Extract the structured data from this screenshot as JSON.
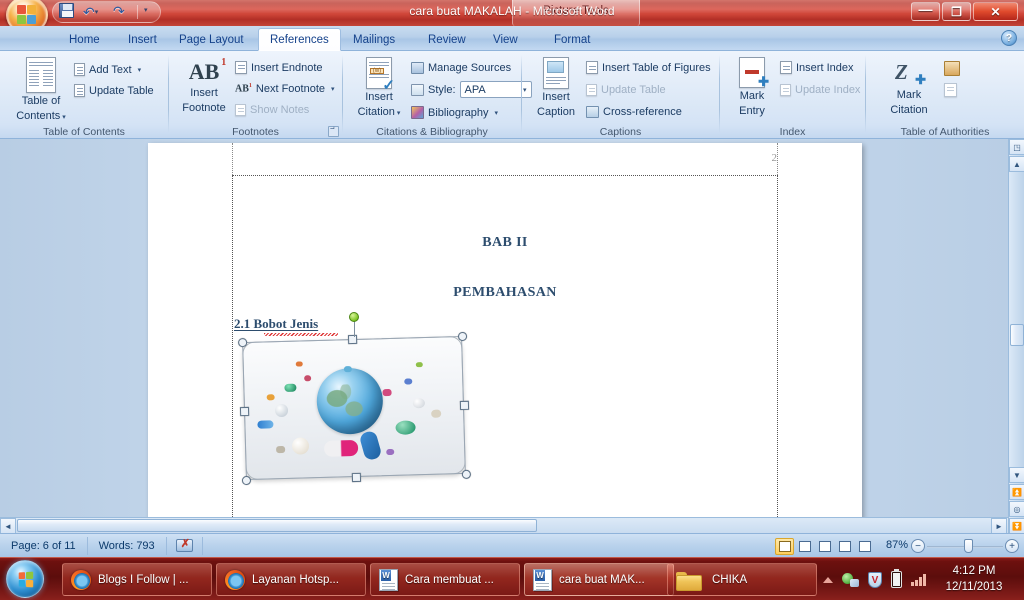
{
  "window": {
    "title": "cara buat MAKALAH - Microsoft Word",
    "contextual_tab": "Picture Tools",
    "minimize": "—",
    "maximize": "❐",
    "close": "✕",
    "help": "?"
  },
  "quick_access": {
    "save": "save-icon",
    "undo": "undo-icon",
    "redo": "redo-icon",
    "customize": "customize-qat-icon"
  },
  "tabs": [
    {
      "label": "Home",
      "active": false
    },
    {
      "label": "Insert",
      "active": false
    },
    {
      "label": "Page Layout",
      "active": false
    },
    {
      "label": "References",
      "active": true
    },
    {
      "label": "Mailings",
      "active": false
    },
    {
      "label": "Review",
      "active": false
    },
    {
      "label": "View",
      "active": false
    },
    {
      "label": "Format",
      "active": false
    }
  ],
  "ribbon": {
    "groups": [
      {
        "label": "Table of Contents",
        "big_button": "Table of\nContents",
        "big_button_line1": "Table of",
        "big_button_line2": "Contents",
        "items": [
          {
            "label": "Add Text",
            "dropdown": true,
            "disabled": false
          },
          {
            "label": "Update Table",
            "dropdown": false,
            "disabled": false
          }
        ]
      },
      {
        "label": "Footnotes",
        "big_button_line1": "Insert",
        "big_button_line2": "Footnote",
        "big_button_icon": "AB",
        "items": [
          {
            "label": "Insert Endnote",
            "dropdown": false,
            "disabled": false
          },
          {
            "label": "Next Footnote",
            "dropdown": true,
            "disabled": false
          },
          {
            "label": "Show Notes",
            "dropdown": false,
            "disabled": true
          }
        ],
        "has_launcher": true
      },
      {
        "label": "Citations & Bibliography",
        "big_button_line1": "Insert",
        "big_button_line2": "Citation",
        "items": [
          {
            "label": "Manage Sources",
            "dropdown": false,
            "disabled": false
          },
          {
            "label": "Style:",
            "dropdown": false,
            "disabled": false
          },
          {
            "label": "Bibliography",
            "dropdown": true,
            "disabled": false
          }
        ],
        "style_value": "APA"
      },
      {
        "label": "Captions",
        "big_button_line1": "Insert",
        "big_button_line2": "Caption",
        "items": [
          {
            "label": "Insert Table of Figures",
            "dropdown": false,
            "disabled": false
          },
          {
            "label": "Update Table",
            "dropdown": false,
            "disabled": true
          },
          {
            "label": "Cross-reference",
            "dropdown": false,
            "disabled": false
          }
        ]
      },
      {
        "label": "Index",
        "big_button_line1": "Mark",
        "big_button_line2": "Entry",
        "items": [
          {
            "label": "Insert Index",
            "dropdown": false,
            "disabled": false
          },
          {
            "label": "Update Index",
            "dropdown": false,
            "disabled": true
          }
        ]
      },
      {
        "label": "Table of Authorities",
        "big_button_line1": "Mark",
        "big_button_line2": "Citation",
        "items": []
      }
    ]
  },
  "document": {
    "page_number_header": "2",
    "heading1": "BAB II",
    "heading2": "PEMBAHASAN",
    "subheading": "2.1 Bobot Jenis",
    "image_alt": "pills-and-globe-picture",
    "image_selected": true
  },
  "status_bar": {
    "page": "Page: 6 of 11",
    "words": "Words: 793",
    "proofing_icon": "proofing-errors-icon",
    "zoom_level": "87%",
    "zoom_out": "−",
    "zoom_in": "+",
    "view_buttons": [
      {
        "name": "print-layout",
        "active": true
      },
      {
        "name": "full-screen-reading",
        "active": false
      },
      {
        "name": "web-layout",
        "active": false
      },
      {
        "name": "outline",
        "active": false
      },
      {
        "name": "draft",
        "active": false
      }
    ]
  },
  "taskbar": {
    "start": "start-orb",
    "items": [
      {
        "label": "Blogs I Follow | ...",
        "icon": "firefox-icon",
        "active": false
      },
      {
        "label": "Layanan Hotsp...",
        "icon": "firefox-icon",
        "active": false
      },
      {
        "label": "Cara membuat ...",
        "icon": "word-icon",
        "active": false
      },
      {
        "label": "cara buat MAK...",
        "icon": "word-icon",
        "active": true
      },
      {
        "label": "CHIKA",
        "icon": "folder-icon",
        "active": false
      }
    ],
    "tray": [
      "show-hidden-icons",
      "network-icon",
      "security-shield-icon",
      "battery-icon",
      "signal-bars-icon"
    ],
    "clock_time": "4:12 PM",
    "clock_date": "12/11/2013"
  },
  "colors": {
    "title_bar": "#c0392b",
    "ribbon": "#d4e3f5",
    "tab_text": "#15428b",
    "heading_text": "#2d4d6e",
    "taskbar": "#6d110f"
  }
}
